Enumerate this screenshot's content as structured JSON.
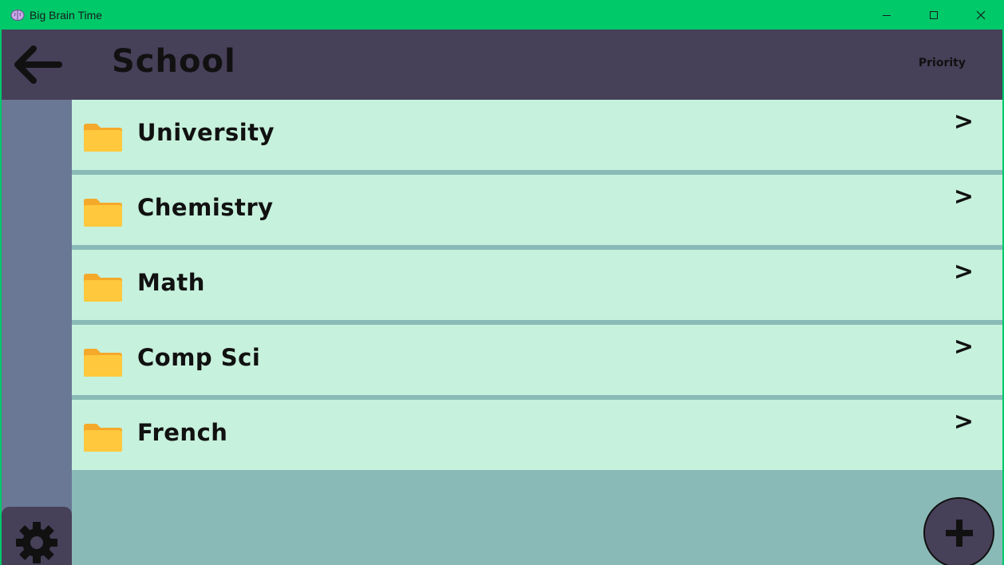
{
  "window": {
    "title": "Big Brain Time",
    "app_icon": "brain-icon",
    "controls": [
      "minimize-icon",
      "maximize-icon",
      "close-icon"
    ]
  },
  "header": {
    "back_icon": "arrow-left-icon",
    "title": "School",
    "sort_label": "Priority"
  },
  "folders": [
    {
      "label": "University",
      "icon": "folder-icon",
      "chevron": ">"
    },
    {
      "label": "Chemistry",
      "icon": "folder-icon",
      "chevron": ">"
    },
    {
      "label": "Math",
      "icon": "folder-icon",
      "chevron": ">"
    },
    {
      "label": "Comp Sci",
      "icon": "folder-icon",
      "chevron": ">"
    },
    {
      "label": "French",
      "icon": "folder-icon",
      "chevron": ">"
    }
  ],
  "sidebar": {
    "settings_icon": "gear-icon"
  },
  "fab": {
    "icon": "plus-icon"
  },
  "colors": {
    "titlebar": "#00c96a",
    "header": "#474059",
    "sidebar": "#6a7895",
    "row": "#c6f1dc",
    "background": "#8abab8",
    "folder": "#ffc83d"
  }
}
